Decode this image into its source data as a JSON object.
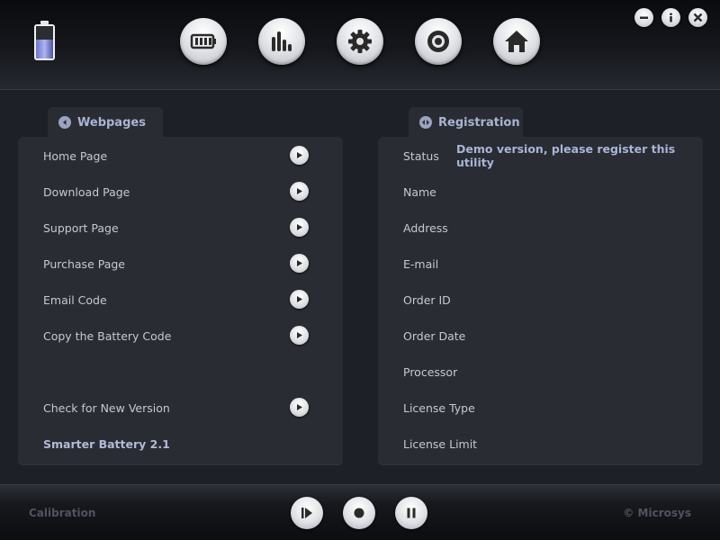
{
  "header": {
    "battery_icon": "battery-icon",
    "nav": [
      {
        "name": "battery-status-button",
        "icon": "battery-level-icon"
      },
      {
        "name": "statistics-button",
        "icon": "bar-chart-icon"
      },
      {
        "name": "settings-button",
        "icon": "gear-icon"
      },
      {
        "name": "calibration-button",
        "icon": "target-icon"
      },
      {
        "name": "home-button",
        "icon": "home-icon"
      }
    ],
    "window_controls": [
      "minimize-icon",
      "info-icon",
      "close-icon"
    ]
  },
  "webpages": {
    "tab_label": "Webpages",
    "items": [
      {
        "label": "Home Page"
      },
      {
        "label": "Download Page"
      },
      {
        "label": "Support Page"
      },
      {
        "label": "Purchase Page"
      },
      {
        "label": "Email Code"
      },
      {
        "label": "Copy the Battery Code"
      },
      {
        "label": "Check for New Version"
      }
    ],
    "version": "Smarter Battery 2.1"
  },
  "registration": {
    "tab_label": "Registration",
    "status_label": "Status",
    "status_value": "Demo version, please register this utility",
    "fields": [
      {
        "label": "Name"
      },
      {
        "label": "Address"
      },
      {
        "label": "E-mail"
      },
      {
        "label": "Order ID"
      },
      {
        "label": "Order Date"
      },
      {
        "label": "Processor"
      },
      {
        "label": "License Type"
      },
      {
        "label": "License Limit"
      }
    ]
  },
  "footer": {
    "left_text": "Calibration",
    "right_text": "© Microsys",
    "controls": [
      "play-icon",
      "stop-icon",
      "pause-icon"
    ]
  },
  "colors": {
    "accent_text": "#aab4d6",
    "panel": "#292c33",
    "background": "#1d2026"
  }
}
